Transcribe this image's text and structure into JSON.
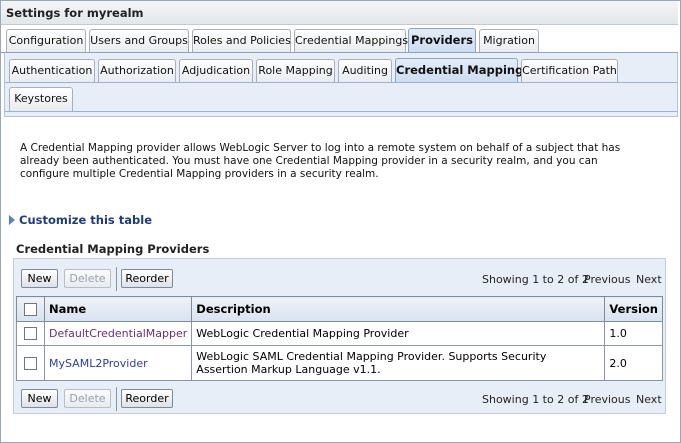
{
  "window": {
    "title": "Settings for myrealm"
  },
  "main_tabs": [
    {
      "label": "Configuration"
    },
    {
      "label": "Users and Groups"
    },
    {
      "label": "Roles and Policies"
    },
    {
      "label": "Credential Mappings"
    },
    {
      "label": "Providers"
    },
    {
      "label": "Migration"
    }
  ],
  "sub_tabs": [
    {
      "label": "Authentication"
    },
    {
      "label": "Authorization"
    },
    {
      "label": "Adjudication"
    },
    {
      "label": "Role Mapping"
    },
    {
      "label": "Auditing"
    },
    {
      "label": "Credential Mapping"
    },
    {
      "label": "Certification Path"
    },
    {
      "label": "Keystores"
    }
  ],
  "description": "A Credential Mapping provider allows WebLogic Server to log into a remote system on behalf of a subject that has already been authenticated. You must have one Credential Mapping provider in a security realm, and you can configure multiple Credential Mapping providers in a security realm.",
  "customize_label": "Customize this table",
  "table": {
    "title": "Credential Mapping Providers",
    "buttons": {
      "new": "New",
      "delete": "Delete",
      "reorder": "Reorder"
    },
    "paging": {
      "showing": "Showing 1 to 2 of 2",
      "previous": "Previous",
      "next": "Next"
    },
    "columns": {
      "name": "Name",
      "description": "Description",
      "version": "Version"
    },
    "rows": [
      {
        "name": "DefaultCredentialMapper",
        "description": "WebLogic Credential Mapping Provider",
        "version": "1.0"
      },
      {
        "name": "MySAML2Provider",
        "description": "WebLogic SAML Credential Mapping Provider. Supports Security Assertion Markup Language v1.1.",
        "version": "2.0"
      }
    ]
  }
}
